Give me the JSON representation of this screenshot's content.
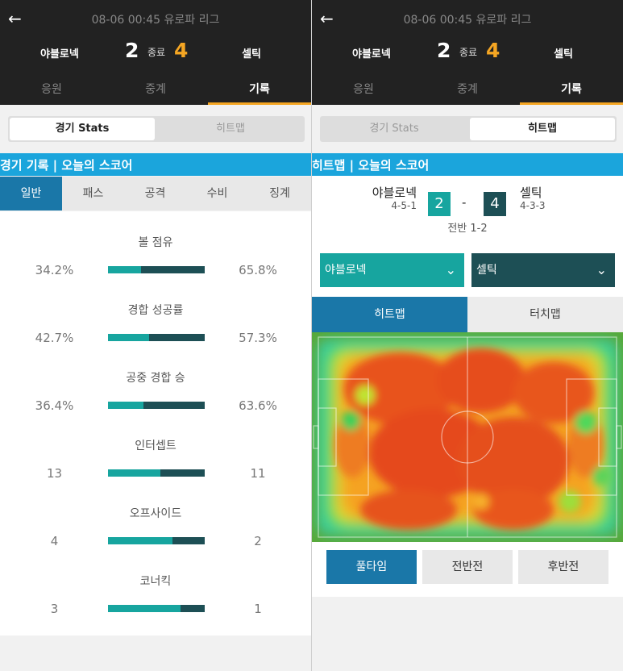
{
  "left": {
    "match_info": "08-06 00:45 유로파 리그",
    "home_team": "야블로넥",
    "away_team": "셀틱",
    "home_score": "2",
    "away_score": "4",
    "status": "종료",
    "tabs": [
      "응원",
      "중계",
      "기록"
    ],
    "active_tab": 2,
    "segments": [
      "경기 Stats",
      "히트맵"
    ],
    "section_title": "경기 기록 | 오늘의 스코어",
    "subtabs": [
      "일반",
      "패스",
      "공격",
      "수비",
      "징계"
    ],
    "stats": [
      {
        "label": "볼 점유",
        "home": "34.2%",
        "away": "65.8%",
        "home_share": 0.342
      },
      {
        "label": "경합 성공률",
        "home": "42.7%",
        "away": "57.3%",
        "home_share": 0.427
      },
      {
        "label": "공중 경합 승",
        "home": "36.4%",
        "away": "63.6%",
        "home_share": 0.364
      },
      {
        "label": "인터셉트",
        "home": "13",
        "away": "11",
        "home_share": 0.54
      },
      {
        "label": "오프사이드",
        "home": "4",
        "away": "2",
        "home_share": 0.67
      },
      {
        "label": "코너킥",
        "home": "3",
        "away": "1",
        "home_share": 0.75
      }
    ]
  },
  "right": {
    "match_info": "08-06 00:45 유로파 리그",
    "home_team": "야블로넥",
    "away_team": "셀틱",
    "home_score": "2",
    "away_score": "4",
    "status": "종료",
    "tabs": [
      "응원",
      "중계",
      "기록"
    ],
    "segments": [
      "경기 Stats",
      "히트맵"
    ],
    "section_title": "히트맵 | 오늘의 스코어",
    "home_formation": "4-5-1",
    "away_formation": "4-3-3",
    "half_score": "전반 1-2",
    "home_select": "야블로넥",
    "away_select": "셀틱",
    "map_tabs": [
      "히트맵",
      "터치맵"
    ],
    "period_buttons": [
      "풀타임",
      "전반전",
      "후반전"
    ]
  },
  "colors": {
    "accent": "#f5a623",
    "teal": "#17a59f",
    "dark_teal": "#1d4f55",
    "blue": "#1a77a8",
    "section": "#1ba5dc"
  }
}
